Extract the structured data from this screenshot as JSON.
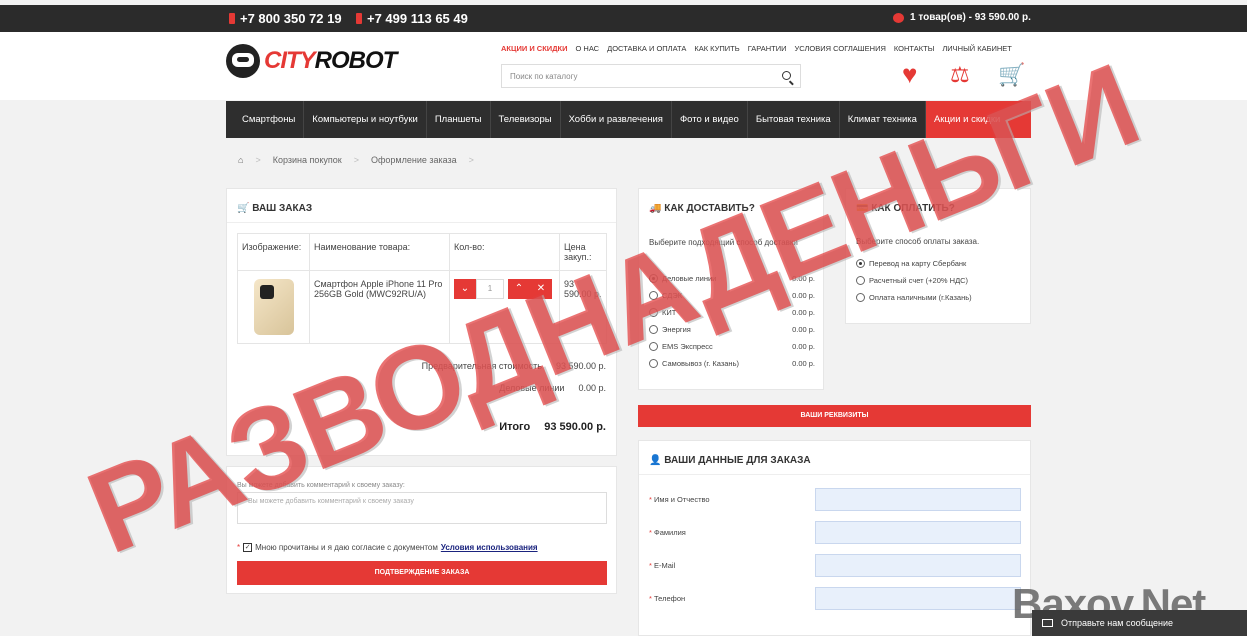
{
  "topbar": {
    "phone1": "+7 800 350 72 19",
    "phone2": "+7 499 113 65 49",
    "cart_summary": "1 товар(ов) - 93 590.00 р."
  },
  "logo": {
    "part1": "CITY",
    "part2": "ROBOT"
  },
  "top_nav": [
    "АКЦИИ И СКИДКИ",
    "О НАС",
    "ДОСТАВКА И ОПЛАТА",
    "КАК КУПИТЬ",
    "ГАРАНТИИ",
    "УСЛОВИЯ СОГЛАШЕНИЯ",
    "КОНТАКТЫ",
    "ЛИЧНЫЙ КАБИНЕТ"
  ],
  "search": {
    "placeholder": "Поиск по каталогу"
  },
  "categories": [
    "Смартфоны",
    "Компьютеры и ноутбуки",
    "Планшеты",
    "Телевизоры",
    "Хобби и развлечения",
    "Фото и видео",
    "Бытовая техника",
    "Климат техника",
    "Акции и скидки"
  ],
  "breadcrumb": [
    "Корзина покупок",
    "Оформление заказа"
  ],
  "order": {
    "title": "ВАШ ЗАКАЗ",
    "headers": [
      "Изображение:",
      "Наименование товара:",
      "Кол-во:",
      "Цена закуп.:"
    ],
    "item_name": "Смартфон Apple iPhone 11 Pro 256GB Gold (MWC92RU/A)",
    "qty": "1",
    "price": "93 590.00 р.",
    "subtotal_label": "Предварительная стоимость",
    "subtotal_value": "93 590.00 р.",
    "shipping_label": "Деловые линии",
    "shipping_value": "0.00 р.",
    "total_label": "Итого",
    "total_value": "93 590.00 р."
  },
  "comment": {
    "label": "Вы можете добавить комментарий к своему заказу:",
    "placeholder": "Вы можете добавить комментарий к своему заказу",
    "agree_text": "Мною прочитаны и я даю согласие с документом",
    "agree_link": "Условия использования",
    "confirm_button": "ПОДТВЕРЖДЕНИЕ ЗАКАЗА"
  },
  "delivery": {
    "title": "КАК ДОСТАВИТЬ?",
    "hint": "Выберите подходящий способ доставки",
    "options": [
      {
        "name": "Деловые линии",
        "price": "0.00 р."
      },
      {
        "name": "СДЭК",
        "price": "0.00 р."
      },
      {
        "name": "КИТ",
        "price": "0.00 р."
      },
      {
        "name": "Энергия",
        "price": "0.00 р."
      },
      {
        "name": "EMS Экспресс",
        "price": "0.00 р."
      },
      {
        "name": "Самовывоз (г. Казань)",
        "price": "0.00 р."
      }
    ]
  },
  "payment": {
    "title": "КАК ОПЛАТИТЬ?",
    "hint": "Выберите способ оплаты заказа.",
    "options": [
      "Перевод на карту Сбербанк",
      "Расчетный счет (+20% НДС)",
      "Оплата наличными (г.Казань)"
    ]
  },
  "requisites_button": "ВАШИ РЕКВИЗИТЫ",
  "your_data": {
    "title": "ВАШИ ДАННЫЕ ДЛЯ ЗАКАЗА",
    "fields": [
      "Имя и Отчество",
      "Фамилия",
      "E-Mail",
      "Телефон"
    ]
  },
  "watermark": "РАЗВОДНАДЕНЬГИ",
  "brand_watermark": "Baxov.Net",
  "chat": {
    "label": "Отправьте нам сообщение"
  },
  "colors": {
    "accent": "#e53935",
    "dark": "#2e2e2e"
  }
}
